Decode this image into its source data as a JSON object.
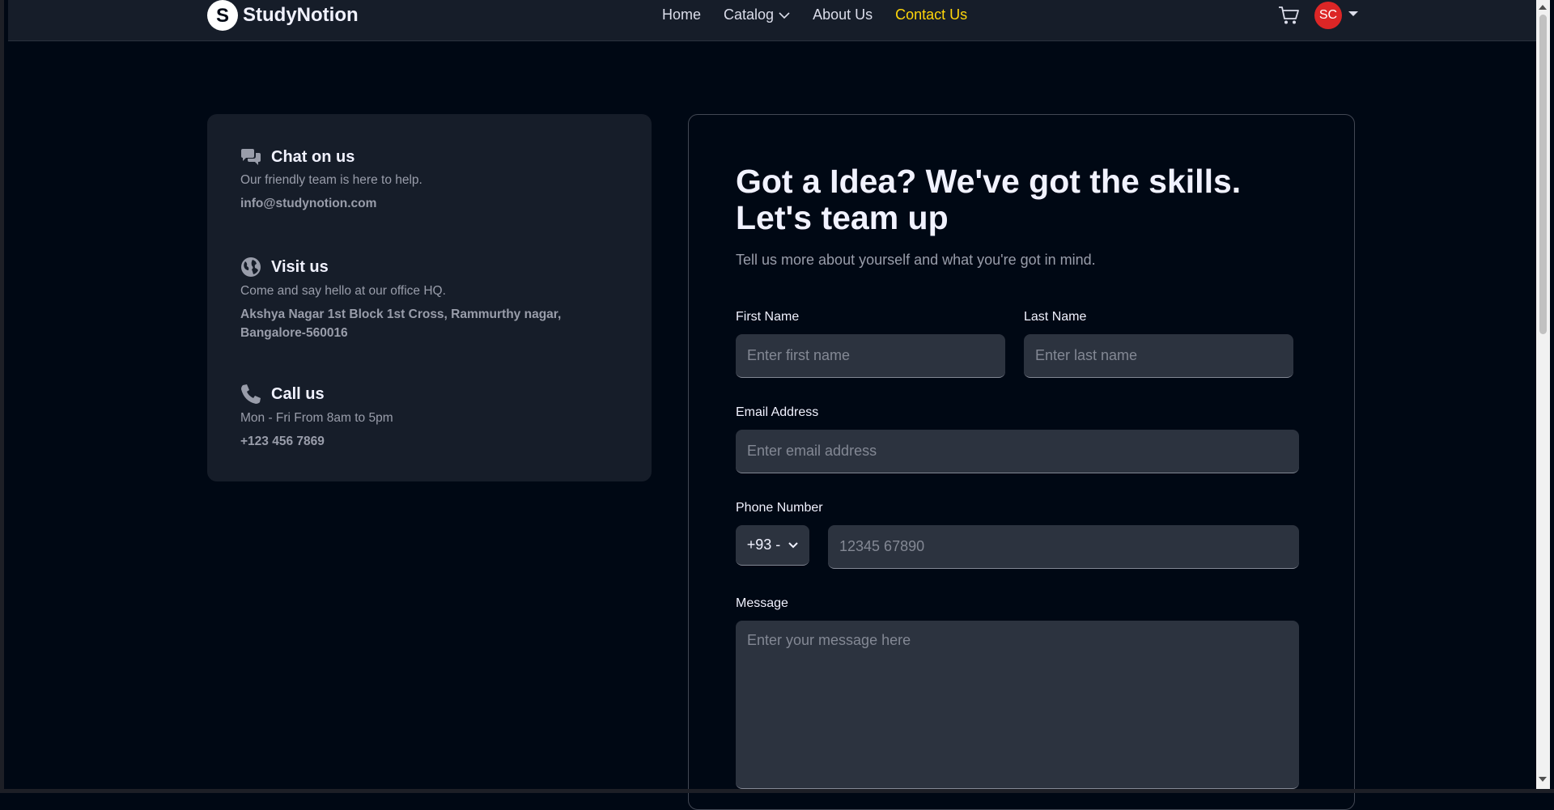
{
  "navbar": {
    "brand": "StudyNotion",
    "links": [
      {
        "label": "Home"
      },
      {
        "label": "Catalog"
      },
      {
        "label": "About Us"
      },
      {
        "label": "Contact Us",
        "active": true
      }
    ],
    "avatar_initials": "SC",
    "cart_icon": "cart-icon"
  },
  "info": {
    "chat": {
      "icon": "chat-icon",
      "title": "Chat on us",
      "subtitle": "Our friendly team is here to help.",
      "detail": "info@studynotion.com"
    },
    "visit": {
      "icon": "globe-icon",
      "title": "Visit us",
      "subtitle": "Come and say hello at our office HQ.",
      "detail": "Akshya Nagar 1st Block 1st Cross, Rammurthy nagar, Bangalore-560016"
    },
    "call": {
      "icon": "phone-icon",
      "title": "Call us",
      "subtitle": "Mon - Fri From 8am to 5pm",
      "detail": "+123 456 7869"
    }
  },
  "form": {
    "heading": "Got a Idea? We've got the skills. Let's team up",
    "subheading": "Tell us more about yourself and what you're got in mind.",
    "first_name": {
      "label": "First Name",
      "placeholder": "Enter first name"
    },
    "last_name": {
      "label": "Last Name",
      "placeholder": "Enter last name"
    },
    "email": {
      "label": "Email Address",
      "placeholder": "Enter email address"
    },
    "phone": {
      "label": "Phone Number",
      "code": "+93 -",
      "placeholder": "12345 67890"
    },
    "message": {
      "label": "Message",
      "placeholder": "Enter your message here"
    }
  },
  "colors": {
    "background": "#000814",
    "card": "#161d29",
    "input": "#2c333f",
    "accent": "#ffd60a",
    "avatar": "#dc2626"
  }
}
